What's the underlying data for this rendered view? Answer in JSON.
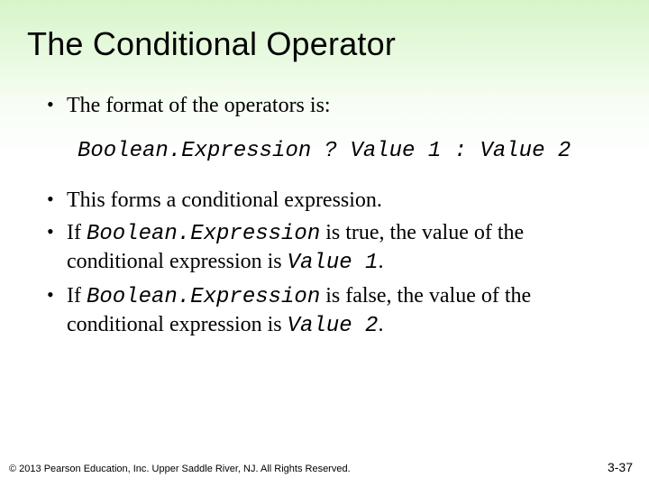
{
  "title": "The Conditional Operator",
  "bullets": {
    "b1": "The format of the operators is:",
    "b2": "This forms a conditional expression.",
    "b3_pre": "If ",
    "b3_code": "Boolean.Expression",
    "b3_mid": " is true, the value of the conditional expression is ",
    "b3_code2": "Value 1",
    "b3_end": ".",
    "b4_pre": "If ",
    "b4_code": "Boolean.Expression",
    "b4_mid": " is false, the value of the conditional expression is ",
    "b4_code2": "Value 2",
    "b4_end": "."
  },
  "codeblock": "Boolean.Expression ? Value 1 : Value 2",
  "footer": "© 2013 Pearson Education, Inc. Upper Saddle River, NJ. All Rights Reserved.",
  "pagenum": "3-37"
}
